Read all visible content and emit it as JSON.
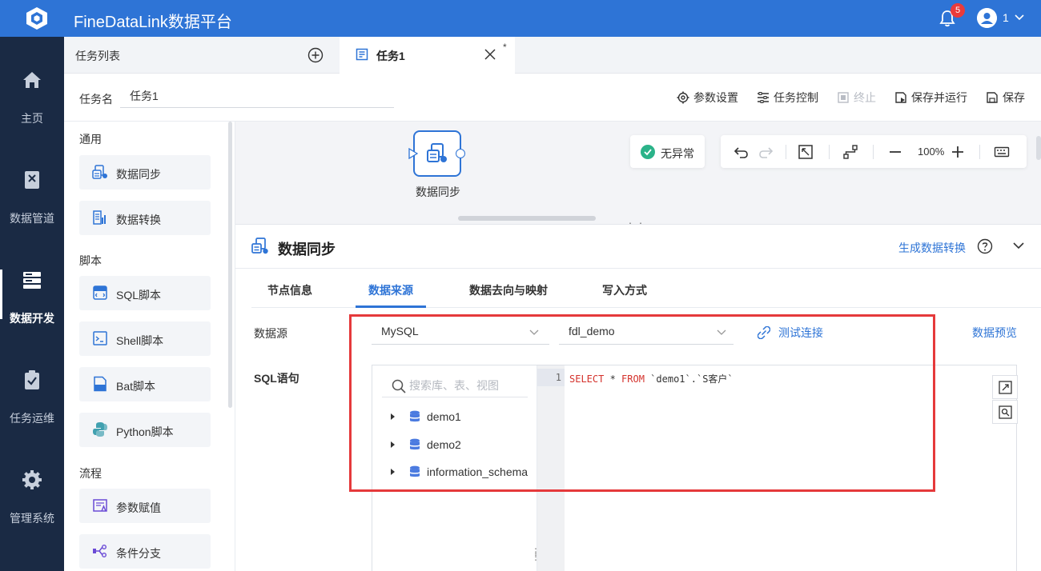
{
  "app": {
    "title": "FineDataLink数据平台",
    "notif_count": "5",
    "user": "1"
  },
  "nav": [
    {
      "label": "主页",
      "icon": "home-icon"
    },
    {
      "label": "数据管道",
      "icon": "pipeline-icon"
    },
    {
      "label": "数据开发",
      "icon": "dev-icon",
      "active": true
    },
    {
      "label": "任务运维",
      "icon": "ops-icon"
    },
    {
      "label": "管理系统",
      "icon": "gear-icon"
    }
  ],
  "tabs": {
    "list_label": "任务列表",
    "task_label": "任务1",
    "modified_mark": "*"
  },
  "task": {
    "name_label": "任务名",
    "name_value": "任务1"
  },
  "toolbar": {
    "params": "参数设置",
    "control": "任务控制",
    "stop": "终止",
    "save_run": "保存并运行",
    "save": "保存"
  },
  "palette": {
    "groups": [
      "通用",
      "脚本",
      "流程"
    ],
    "items": [
      "数据同步",
      "数据转换",
      "SQL脚本",
      "Shell脚本",
      "Bat脚本",
      "Python脚本",
      "参数赋值",
      "条件分支"
    ]
  },
  "canvas": {
    "node_label": "数据同步",
    "status": "无异常",
    "zoom": "100%"
  },
  "detail": {
    "title": "数据同步",
    "gen_link": "生成数据转换",
    "tabs": [
      "节点信息",
      "数据来源",
      "数据去向与映射",
      "写入方式"
    ],
    "active_tab": "数据来源",
    "datasource_label": "数据源",
    "db_type": "MySQL",
    "connection": "fdl_demo",
    "test_conn": "测试连接",
    "preview": "数据预览",
    "sql_label": "SQL语句",
    "search_placeholder": "搜索库、表、视图",
    "tree": [
      "demo1",
      "demo2",
      "information_schema"
    ],
    "line_no": "1",
    "sql_kw1": "SELECT",
    "sql_mid": " * ",
    "sql_kw2": "FROM",
    "sql_rest": " `demo1`.`S客户`"
  },
  "colors": {
    "accent": "#2e74d6",
    "nav_bg": "#1a2a44",
    "highlight": "#e5393b"
  }
}
